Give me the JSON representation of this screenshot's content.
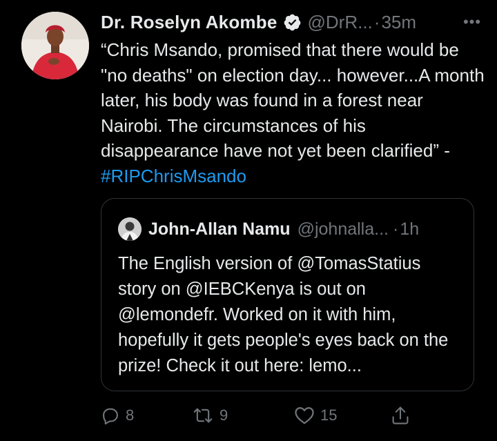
{
  "tweet": {
    "author_name": "Dr. Roselyn Akombe",
    "handle": "@DrR...",
    "separator": "·",
    "time": "35m",
    "more_label": "•••",
    "text_main": "“Chris Msando, promised that there would be \"no deaths\" on election day... however...A month later, his body was found in a forest near Nairobi. The circumstances of his disappearance have not yet been clarified” - ",
    "hashtag": "#RIPChrisMsando"
  },
  "quoted_tweet": {
    "author_name": "John-Allan Namu",
    "handle": "@johnalla...",
    "separator": "·",
    "time": "1h",
    "text": "The English version of @TomasStatius story on @IEBCKenya is out on @lemondefr. Worked on it with him, hopefully it gets people's eyes back on the prize! Check it out here: lemo..."
  },
  "actions": {
    "replies": "8",
    "retweets": "9",
    "likes": "15"
  },
  "colors": {
    "background": "#000000",
    "text": "#e7e9ea",
    "secondary": "#71767b",
    "accent": "#1d9bf0",
    "border": "#2f3336"
  }
}
